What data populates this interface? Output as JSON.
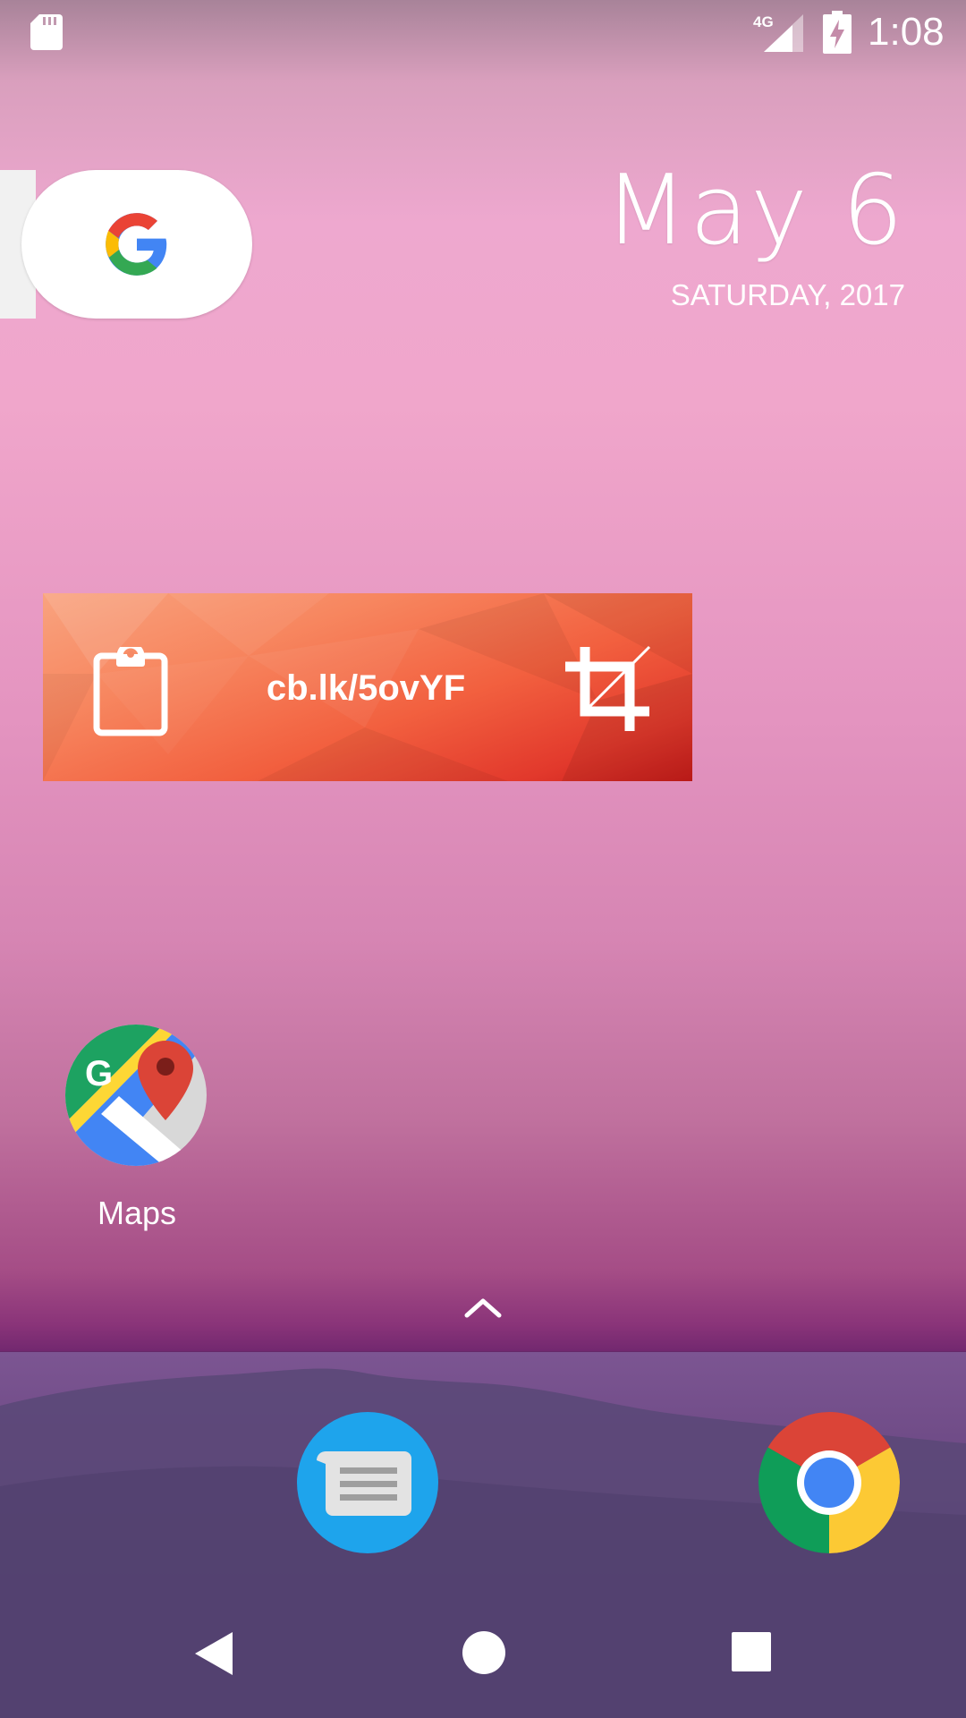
{
  "status_bar": {
    "time": "1:08",
    "network": "4G",
    "icons": [
      "sd-card-icon",
      "signal-4g-icon",
      "battery-charging-icon"
    ]
  },
  "search_widget": {
    "icon": "google-g-icon"
  },
  "date_widget": {
    "date": "May 6",
    "day_year": "SATURDAY, 2017"
  },
  "clipboard_widget": {
    "text": "cb.lk/5ovYF",
    "left_icon": "clipboard-icon",
    "right_icon": "crop-icon"
  },
  "apps": [
    {
      "label": "Maps",
      "icon": "google-maps-icon"
    }
  ],
  "dock": {
    "drawer_icon": "chevron-up-icon",
    "apps": [
      {
        "icon": "messages-icon"
      },
      {
        "icon": "chrome-icon"
      }
    ]
  },
  "nav_bar": {
    "buttons": [
      "back-icon",
      "home-icon",
      "recents-icon"
    ]
  },
  "colors": {
    "wallpaper_top": "#eea8cf",
    "wallpaper_bottom": "#72286f",
    "dock": "#5a2a63",
    "widget_orange": "#f2603f",
    "messages_blue": "#1ea4ec"
  }
}
